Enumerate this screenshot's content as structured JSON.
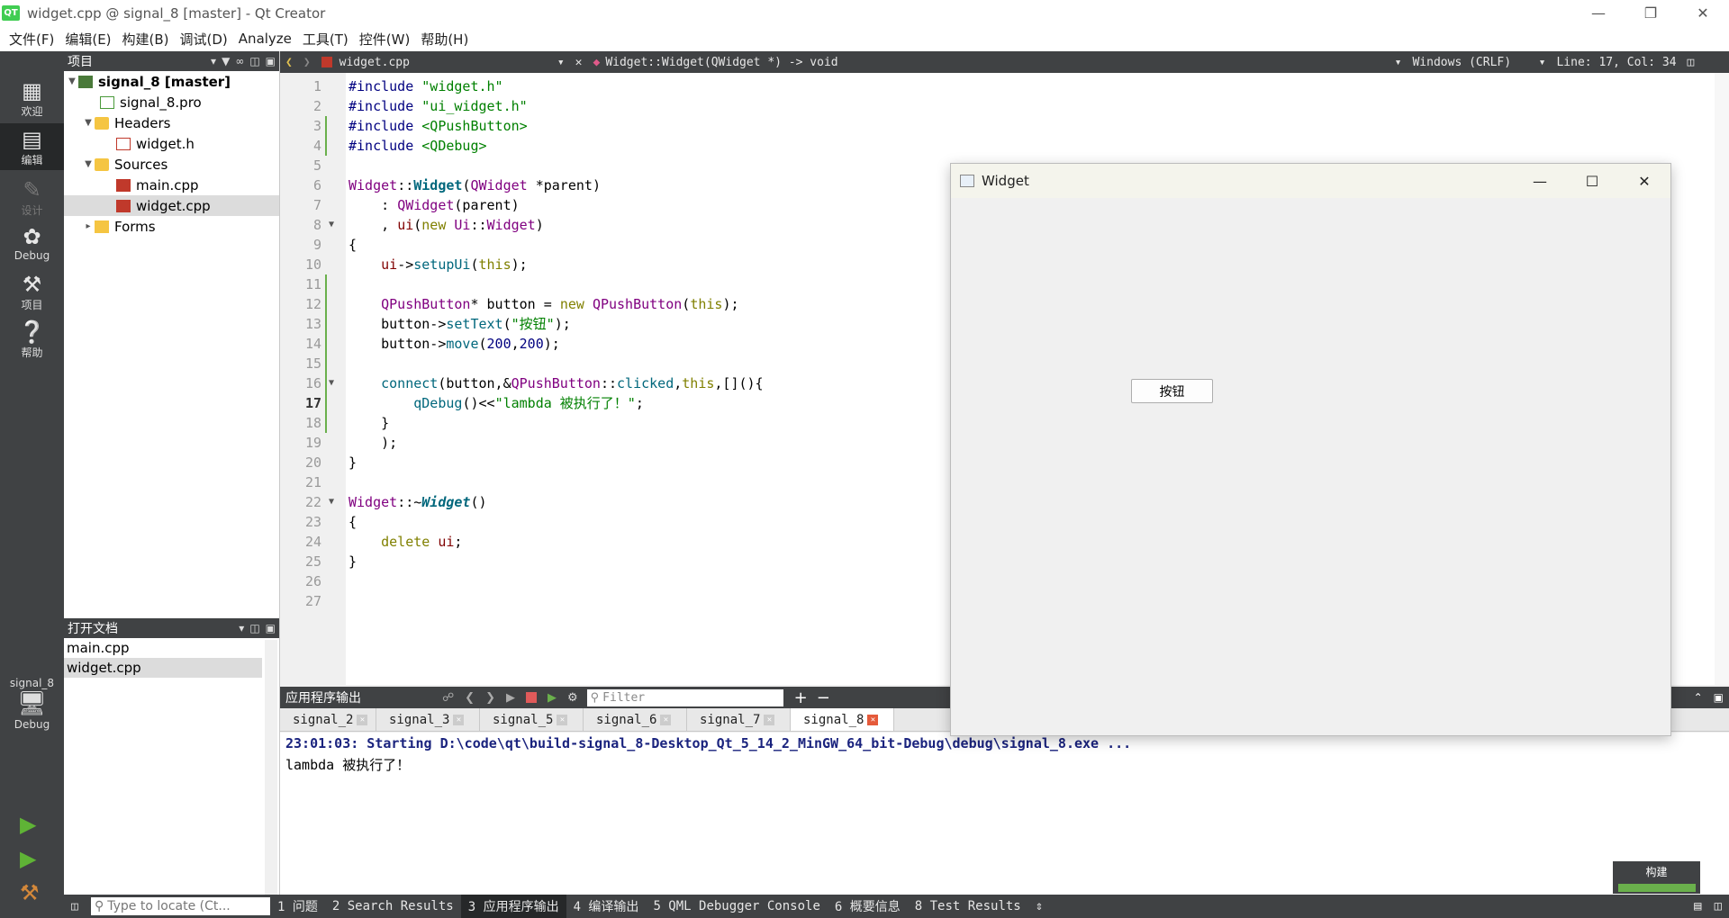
{
  "window": {
    "title": "widget.cpp @ signal_8 [master] - Qt Creator",
    "logo": "QT"
  },
  "menubar": [
    "文件(F)",
    "编辑(E)",
    "构建(B)",
    "调试(D)",
    "Analyze",
    "工具(T)",
    "控件(W)",
    "帮助(H)"
  ],
  "modes": [
    {
      "id": "welcome",
      "label": "欢迎",
      "icon": "grid-icon"
    },
    {
      "id": "edit",
      "label": "编辑",
      "icon": "edit-icon"
    },
    {
      "id": "design",
      "label": "设计",
      "icon": "pencil-icon"
    },
    {
      "id": "debug",
      "label": "Debug",
      "icon": "bug-icon"
    },
    {
      "id": "projects",
      "label": "项目",
      "icon": "wrench-icon"
    },
    {
      "id": "help",
      "label": "帮助",
      "icon": "help-icon"
    }
  ],
  "kit": {
    "name": "signal_8",
    "mode": "Debug"
  },
  "project_pane": {
    "title": "项目",
    "tree": [
      {
        "label": "signal_8 [master]",
        "type": "proj"
      },
      {
        "label": "signal_8.pro",
        "type": "pro"
      },
      {
        "label": "Headers",
        "type": "folder"
      },
      {
        "label": "widget.h",
        "type": "h"
      },
      {
        "label": "Sources",
        "type": "folder"
      },
      {
        "label": "main.cpp",
        "type": "cpp"
      },
      {
        "label": "widget.cpp",
        "type": "cpp"
      },
      {
        "label": "Forms",
        "type": "forms"
      }
    ]
  },
  "open_docs": {
    "title": "打开文档",
    "items": [
      "main.cpp",
      "widget.cpp"
    ]
  },
  "editor_toolbar": {
    "file": "widget.cpp",
    "symbol": "Widget::Widget(QWidget *) -> void",
    "line_endings": "Windows (CRLF)",
    "position": "Line: 17, Col: 34"
  },
  "editor": {
    "line_numbers": [
      "1",
      "2",
      "3",
      "4",
      "5",
      "6",
      "7",
      "8",
      "9",
      "10",
      "11",
      "12",
      "13",
      "14",
      "15",
      "16",
      "17",
      "18",
      "19",
      "20",
      "21",
      "22",
      "23",
      "24",
      "25",
      "26",
      "27"
    ],
    "lines": [
      "#include \"widget.h\"",
      "#include \"ui_widget.h\"",
      "#include <QPushButton>",
      "#include <QDebug>",
      "",
      "Widget::Widget(QWidget *parent)",
      "    : QWidget(parent)",
      "    , ui(new Ui::Widget)",
      "{",
      "    ui->setupUi(this);",
      "",
      "    QPushButton* button = new QPushButton(this);",
      "    button->setText(\"按钮\");",
      "    button->move(200,200);",
      "",
      "    connect(button,&QPushButton::clicked,this,[](){",
      "        qDebug()<<\"lambda 被执行了！\";",
      "    }",
      "    );",
      "}",
      "",
      "Widget::~Widget()",
      "{",
      "    delete ui;",
      "}",
      "",
      ""
    ]
  },
  "output": {
    "title": "应用程序输出",
    "filter_placeholder": "Filter",
    "tabs": [
      "signal_2",
      "signal_3",
      "signal_5",
      "signal_6",
      "signal_7",
      "signal_8"
    ],
    "active_tab": "signal_8",
    "line1": "23:01:03: Starting D:\\code\\qt\\build-signal_8-Desktop_Qt_5_14_2_MinGW_64_bit-Debug\\debug\\signal_8.exe ...",
    "line2": "lambda 被执行了！"
  },
  "build_box": {
    "label": "构建"
  },
  "statusbar": {
    "locator_placeholder": "Type to locate (Ct...",
    "items": [
      "1 问题",
      "2 Search Results",
      "3 应用程序输出",
      "4 编译输出",
      "5 QML Debugger Console",
      "6 概要信息",
      "8 Test Results"
    ],
    "active": "3 应用程序输出"
  },
  "widget_window": {
    "title": "Widget",
    "button_label": "按钮"
  }
}
